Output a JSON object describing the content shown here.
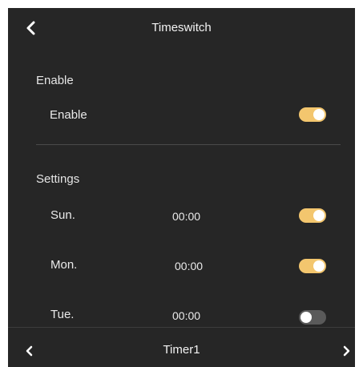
{
  "header": {
    "title": "Timeswitch",
    "back_icon": "chevron-left-icon"
  },
  "enable_section": {
    "heading": "Enable",
    "row": {
      "label": "Enable",
      "enabled": true
    }
  },
  "settings_section": {
    "heading": "Settings",
    "days": [
      {
        "label": "Sun.",
        "time": "00:00",
        "enabled": true
      },
      {
        "label": "Mon.",
        "time": "00:00",
        "enabled": true
      },
      {
        "label": "Tue.",
        "time": "00:00",
        "enabled": false
      }
    ]
  },
  "footer": {
    "title": "Timer1",
    "prev_icon": "chevron-left-icon",
    "next_icon": "chevron-right-icon"
  },
  "colors": {
    "background": "#262626",
    "toggle_on": "#f3c66e",
    "toggle_off": "#5a5a5a",
    "text": "#ffffff"
  }
}
